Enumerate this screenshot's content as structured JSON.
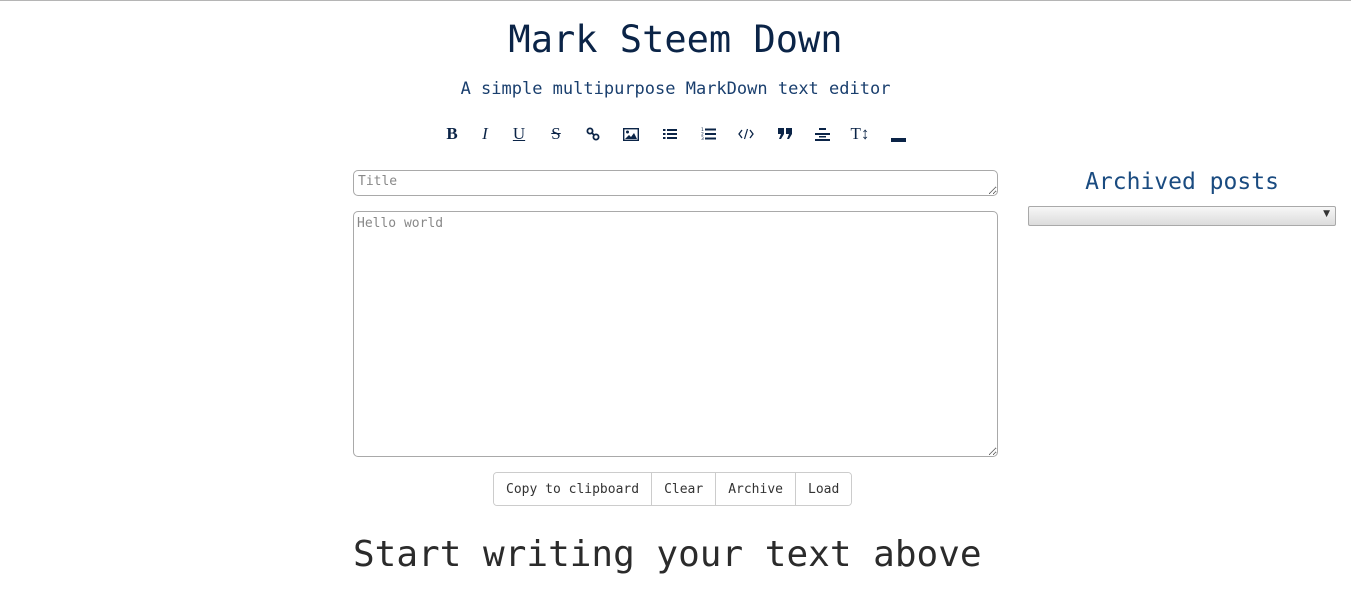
{
  "header": {
    "title": "Mark Steem Down",
    "subtitle": "A simple multipurpose MarkDown text editor"
  },
  "toolbar": {
    "items": [
      {
        "name": "bold",
        "glyph": "B"
      },
      {
        "name": "italic",
        "glyph": "I"
      },
      {
        "name": "underline",
        "glyph": "U"
      },
      {
        "name": "strikethrough",
        "glyph": "S"
      },
      {
        "name": "link",
        "icon": "link-icon"
      },
      {
        "name": "image",
        "icon": "image-icon"
      },
      {
        "name": "bulleted-list",
        "icon": "list-ul-icon"
      },
      {
        "name": "numbered-list",
        "icon": "list-ol-icon"
      },
      {
        "name": "code",
        "icon": "code-icon"
      },
      {
        "name": "quote",
        "icon": "quote-icon"
      },
      {
        "name": "center-align",
        "icon": "align-center-icon"
      },
      {
        "name": "text-size",
        "glyph": "T↕"
      },
      {
        "name": "horizontal-rule",
        "icon": "horizontal-rule-icon"
      }
    ]
  },
  "editor": {
    "title_placeholder": "Title",
    "title_value": "",
    "body_placeholder": "Hello world",
    "body_value": ""
  },
  "actions": {
    "copy": "Copy to clipboard",
    "clear": "Clear",
    "archive": "Archive",
    "load": "Load"
  },
  "preview": {
    "text": "Start writing your text above"
  },
  "archive": {
    "heading": "Archived posts",
    "selected": ""
  },
  "colors": {
    "title": "#0b2447",
    "accent": "#1a4b80"
  }
}
